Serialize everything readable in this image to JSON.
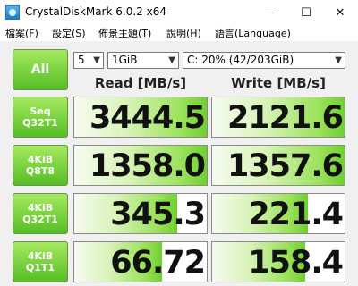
{
  "window": {
    "title": "CrystalDiskMark 6.0.2 x64",
    "minimize": "—",
    "maximize": "☐",
    "close": "✕"
  },
  "menu": {
    "items": [
      "檔案(F)",
      "設定(S)",
      "佈景主題(T)",
      "說明(H)",
      "語言(Language)"
    ]
  },
  "controls": {
    "all_label": "All",
    "count": "5",
    "size": "1GiB",
    "drive": "C: 20% (42/203GiB)"
  },
  "columns": {
    "read": "Read [MB/s]",
    "write": "Write [MB/s]"
  },
  "rows": [
    {
      "label1": "Seq",
      "label2": "Q32T1",
      "read": "3444.5",
      "write": "2121.6",
      "read_fill": 1.0,
      "write_fill": 1.0
    },
    {
      "label1": "4KiB",
      "label2": "Q8T8",
      "read": "1358.0",
      "write": "1357.6",
      "read_fill": 1.0,
      "write_fill": 1.0
    },
    {
      "label1": "4KiB",
      "label2": "Q32T1",
      "read": "345.3",
      "write": "221.4",
      "read_fill": 0.78,
      "write_fill": 0.72
    },
    {
      "label1": "4KiB",
      "label2": "Q1T1",
      "read": "66.72",
      "write": "158.4",
      "read_fill": 0.66,
      "write_fill": 0.7
    }
  ],
  "colors": {
    "accent_green": "#56be25",
    "bar_green": "#6fd02f"
  }
}
